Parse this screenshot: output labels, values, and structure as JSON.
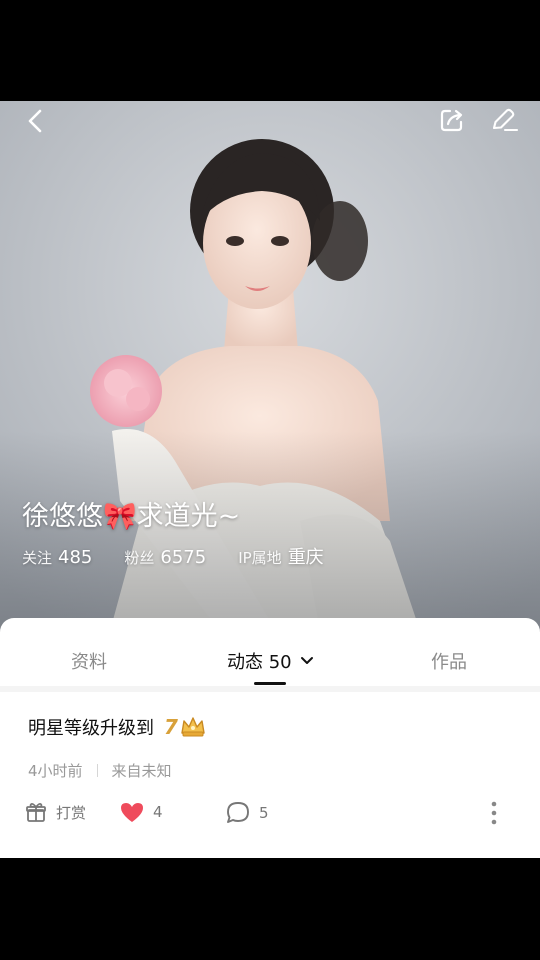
{
  "profile": {
    "name": "徐悠悠🎀求道光~",
    "stats": [
      {
        "label": "关注",
        "value": "485"
      },
      {
        "label": "粉丝",
        "value": "6575"
      },
      {
        "label": "IP属地",
        "value": "重庆"
      }
    ]
  },
  "header_icons": {
    "back": "back-arrow-icon",
    "share": "share-icon",
    "edit": "edit-icon"
  },
  "tabs": {
    "profile": "资料",
    "feed": "动态 50",
    "works": "作品"
  },
  "post": {
    "title": "明星等级升级到",
    "level": "7",
    "level_icon": "crown-icon",
    "time": "4小时前",
    "source": "来自未知",
    "reward_label": "打赏",
    "likes": "4",
    "comments": "5"
  },
  "colors": {
    "like": "#ef4b5c",
    "crown": "#e0a93c",
    "active_tab": "#111111",
    "inactive_tab": "#8a8a8a"
  }
}
